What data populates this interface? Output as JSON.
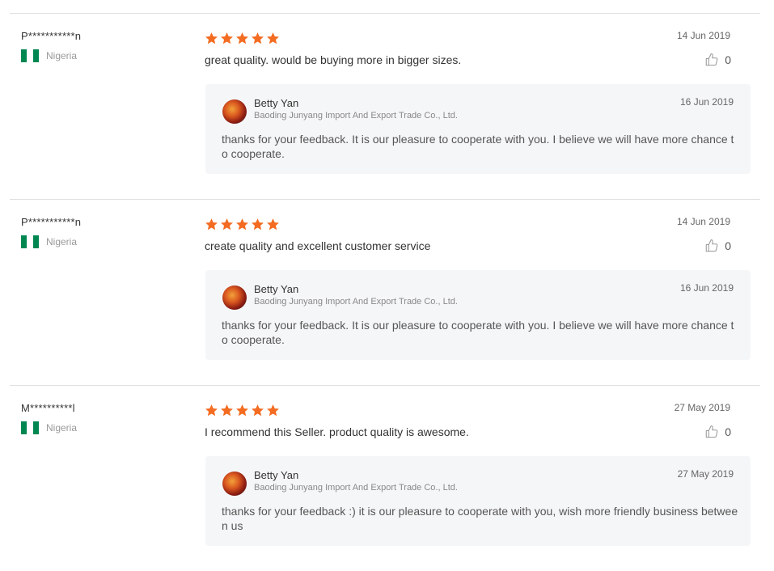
{
  "accent_color": "#f36c21",
  "reviews": [
    {
      "user": "P***********n",
      "country": "Nigeria",
      "rating": 5,
      "date": "14 Jun 2019",
      "comment": "great quality. would be buying more in bigger sizes.",
      "likes": "0",
      "reply": {
        "name": "Betty Yan",
        "company": "Baoding Junyang Import And Export Trade Co., Ltd.",
        "date": "16 Jun 2019",
        "text": "thanks for your feedback. It is our pleasure to cooperate with you. I believe we will have more chance to cooperate."
      }
    },
    {
      "user": "P***********n",
      "country": "Nigeria",
      "rating": 5,
      "date": "14 Jun 2019",
      "comment": "create quality and excellent customer service",
      "likes": "0",
      "reply": {
        "name": "Betty Yan",
        "company": "Baoding Junyang Import And Export Trade Co., Ltd.",
        "date": "16 Jun 2019",
        "text": "thanks for your feedback. It is our pleasure to cooperate with you. I believe we will have more chance to cooperate."
      }
    },
    {
      "user": "M**********l",
      "country": "Nigeria",
      "rating": 5,
      "date": "27 May 2019",
      "comment": "I recommend this Seller. product quality is awesome.",
      "likes": "0",
      "reply": {
        "name": "Betty Yan",
        "company": "Baoding Junyang Import And Export Trade Co., Ltd.",
        "date": "27 May 2019",
        "text": "thanks for your feedback :)  it is our pleasure to cooperate with you, wish more friendly business between us"
      }
    }
  ]
}
